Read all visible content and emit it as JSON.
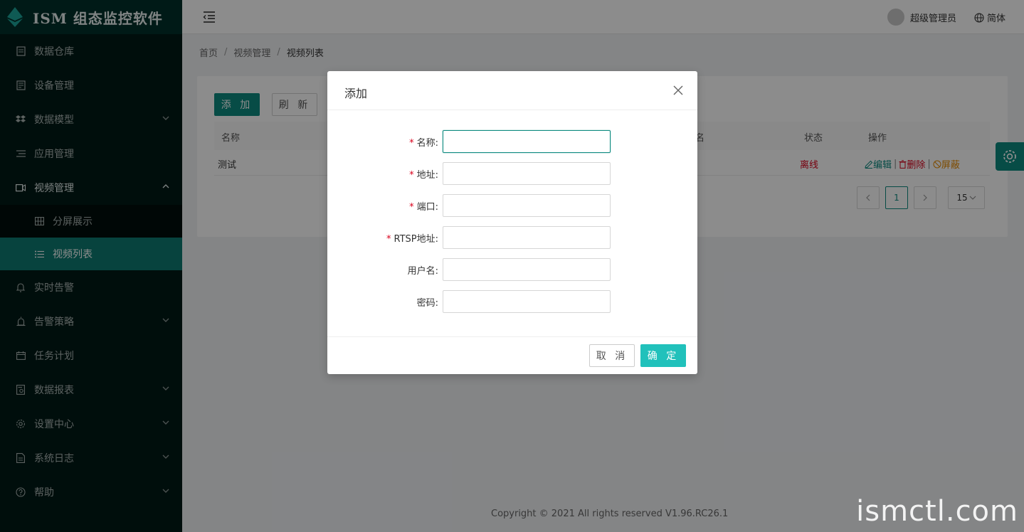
{
  "app": {
    "title": "ISM 组态监控软件"
  },
  "sidebar": {
    "items": [
      {
        "label": "数据仓库",
        "icon": "database-icon",
        "has_chevron": false
      },
      {
        "label": "设备管理",
        "icon": "device-icon",
        "has_chevron": false
      },
      {
        "label": "数据模型",
        "icon": "dropbox-icon",
        "has_chevron": true
      },
      {
        "label": "应用管理",
        "icon": "list-icon",
        "has_chevron": false
      },
      {
        "label": "视频管理",
        "icon": "video-icon",
        "has_chevron": true,
        "open": true
      }
    ],
    "sub_items": [
      {
        "label": "分屏展示",
        "icon": "grid-icon"
      },
      {
        "label": "视频列表",
        "icon": "list-icon",
        "active": true
      }
    ],
    "items_after": [
      {
        "label": "实时告警",
        "icon": "bell-icon",
        "has_chevron": false
      },
      {
        "label": "告警策略",
        "icon": "alarm-icon",
        "has_chevron": true
      },
      {
        "label": "任务计划",
        "icon": "calendar-icon",
        "has_chevron": false
      },
      {
        "label": "数据报表",
        "icon": "report-icon",
        "has_chevron": true
      },
      {
        "label": "设置中心",
        "icon": "gear-icon",
        "has_chevron": true
      },
      {
        "label": "系统日志",
        "icon": "log-icon",
        "has_chevron": true
      },
      {
        "label": "帮助",
        "icon": "help-icon",
        "has_chevron": true
      }
    ]
  },
  "header": {
    "user_name": "超级管理员",
    "language": "简体"
  },
  "breadcrumb": {
    "home": "首页",
    "section": "视频管理",
    "current": "视频列表"
  },
  "toolbar": {
    "add_label": "添 加",
    "refresh_label": "刷 新"
  },
  "table": {
    "columns": {
      "name": "名称",
      "col_partial": "名",
      "status": "状态",
      "actions": "操作"
    },
    "rows": [
      {
        "name": "测试",
        "partial": "",
        "status": "离线",
        "edit": "编辑",
        "delete": "删除",
        "block": "屏蔽"
      }
    ]
  },
  "pagination": {
    "current_page": "1",
    "page_size": "15"
  },
  "footer": {
    "copyright": "Copyright © 2021 All rights reserved V1.96.RC26.1"
  },
  "watermark": "ismctl.com",
  "modal": {
    "title": "添加",
    "fields": [
      {
        "label": "名称:",
        "required": true,
        "value": "",
        "focused": true
      },
      {
        "label": "地址:",
        "required": true,
        "value": ""
      },
      {
        "label": "端口:",
        "required": true,
        "value": ""
      },
      {
        "label": "RTSP地址:",
        "required": true,
        "value": ""
      },
      {
        "label": "用户名:",
        "required": false,
        "value": ""
      },
      {
        "label": "密码:",
        "required": false,
        "value": ""
      }
    ],
    "cancel_label": "取 消",
    "ok_label": "确 定"
  },
  "colors": {
    "primary": "#0e8a80",
    "confirm": "#21c1bb",
    "danger": "#d9001b",
    "warning": "#e68a00",
    "sidebar_bg": "#001a17"
  }
}
